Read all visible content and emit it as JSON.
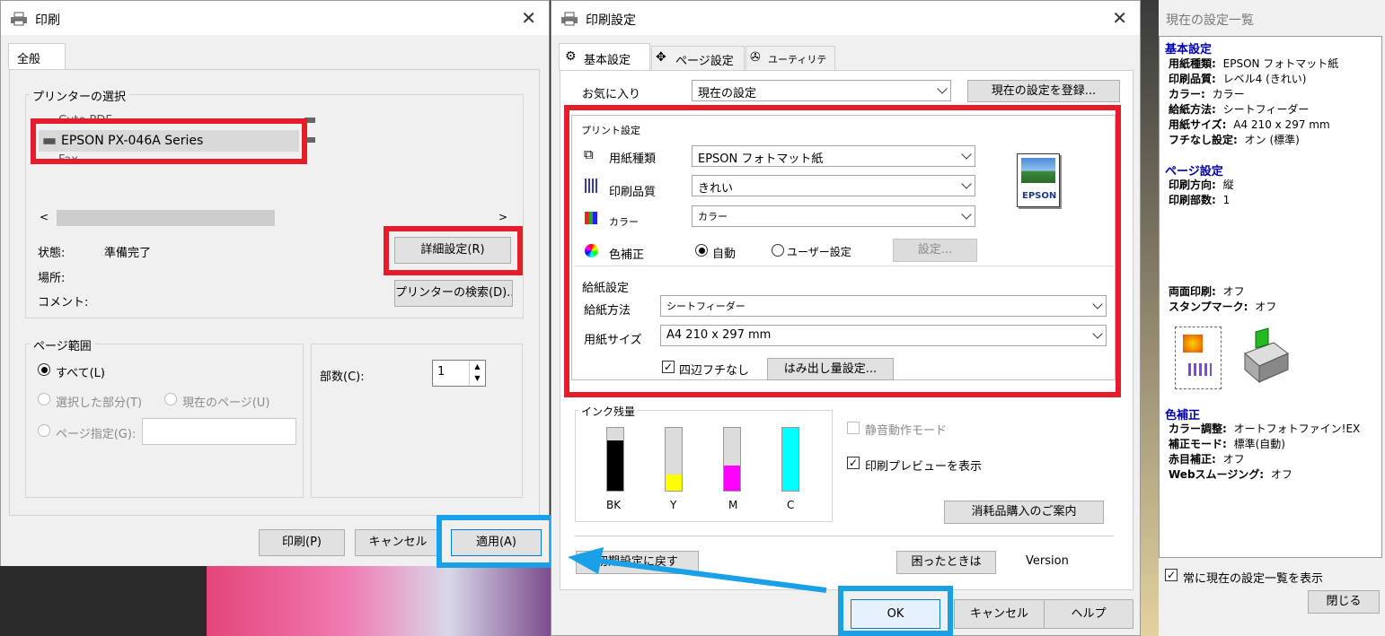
{
  "print_dialog": {
    "title": "印刷",
    "tab": "全般",
    "printer_group_label": "プリンターの選択",
    "printers": [
      "Cute PDF",
      "EPSON PX-046A Series",
      "Fax"
    ],
    "status_label": "状態:",
    "status_value": "準備完了",
    "location_label": "場所:",
    "comment_label": "コメント:",
    "advanced_button": "詳細設定(R)",
    "find_printer_button": "プリンターの検索(D)...",
    "page_range_label": "ページ範囲",
    "all_label": "すべて(L)",
    "selection_label": "選択した部分(T)",
    "current_page_label": "現在のページ(U)",
    "pages_label": "ページ指定(G):",
    "copies_label": "部数(C):",
    "copies_value": "1",
    "print_button": "印刷(P)",
    "cancel_button": "キャンセル",
    "apply_button": "適用(A)"
  },
  "settings_dialog": {
    "title": "印刷設定",
    "tabs": [
      "基本設定",
      "ページ設定",
      "ユーティリティー"
    ],
    "favorites_label": "お気に入り",
    "favorites_value": "現在の設定",
    "register_button": "現在の設定を登録...",
    "print_settings_label": "プリント設定",
    "paper_type_label": "用紙種類",
    "paper_type_value": "EPSON フォトマット紙",
    "quality_label": "印刷品質",
    "quality_value": "きれい",
    "color_label": "カラー",
    "color_value": "カラー",
    "color_correction_label": "色補正",
    "auto_label": "自動",
    "user_setting_label": "ユーザー設定",
    "setting_button": "設定...",
    "epson_logo": "EPSON",
    "feed_settings_label": "給紙設定",
    "feed_method_label": "給紙方法",
    "feed_method_value": "シートフィーダー",
    "paper_size_label": "用紙サイズ",
    "paper_size_value": "A4 210 x 297 mm",
    "borderless_label": "四辺フチなし",
    "borderless_checked": true,
    "overflow_button": "はみ出し量設定...",
    "ink_label": "インク残量",
    "inks": [
      {
        "name": "BK",
        "level": 0.8,
        "color": "#000000"
      },
      {
        "name": "Y",
        "level": 0.25,
        "color": "#ffff00"
      },
      {
        "name": "M",
        "level": 0.4,
        "color": "#ff00ff"
      },
      {
        "name": "C",
        "level": 1.0,
        "color": "#00ffff"
      }
    ],
    "quiet_mode_label": "静音動作モード",
    "preview_label": "印刷プレビューを表示",
    "preview_checked": true,
    "supplies_button": "消耗品購入のご案内",
    "reset_button": "初期設定に戻す",
    "trouble_button": "困ったときは",
    "version_label": "Version",
    "ok_button": "OK",
    "cancel_button": "キャンセル",
    "help_button": "ヘルプ"
  },
  "summary_panel": {
    "title": "現在の設定一覧",
    "basic_heading": "基本設定",
    "basic_items": [
      {
        "k": "用紙種類:",
        "v": "EPSON フォトマット紙"
      },
      {
        "k": "印刷品質:",
        "v": "レベル4 (きれい)"
      },
      {
        "k": "カラー:",
        "v": "カラー"
      },
      {
        "k": "給紙方法:",
        "v": "シートフィーダー"
      },
      {
        "k": "用紙サイズ:",
        "v": "A4 210 x 297 mm"
      },
      {
        "k": "フチなし設定:",
        "v": "オン (標準)"
      }
    ],
    "page_heading": "ページ設定",
    "page_items": [
      {
        "k": "印刷方向:",
        "v": "縦"
      },
      {
        "k": "印刷部数:",
        "v": "1"
      }
    ],
    "duplex": {
      "k": "両面印刷:",
      "v": "オフ"
    },
    "stamp": {
      "k": "スタンプマーク:",
      "v": "オフ"
    },
    "color_heading": "色補正",
    "color_items": [
      {
        "k": "カラー調整:",
        "v": "オートフォトファイン!EX"
      },
      {
        "k": "補正モード:",
        "v": "標準(自動)"
      },
      {
        "k": "赤目補正:",
        "v": "オフ"
      },
      {
        "k": "Webスムージング:",
        "v": "オフ"
      }
    ],
    "always_show_label": "常に現在の設定一覧を表示",
    "always_show_checked": true,
    "close_button": "閉じる"
  },
  "colors": {
    "highlight_red": "#e41c2b",
    "highlight_blue": "#1aa0e6",
    "heading_blue": "#0000aa"
  }
}
